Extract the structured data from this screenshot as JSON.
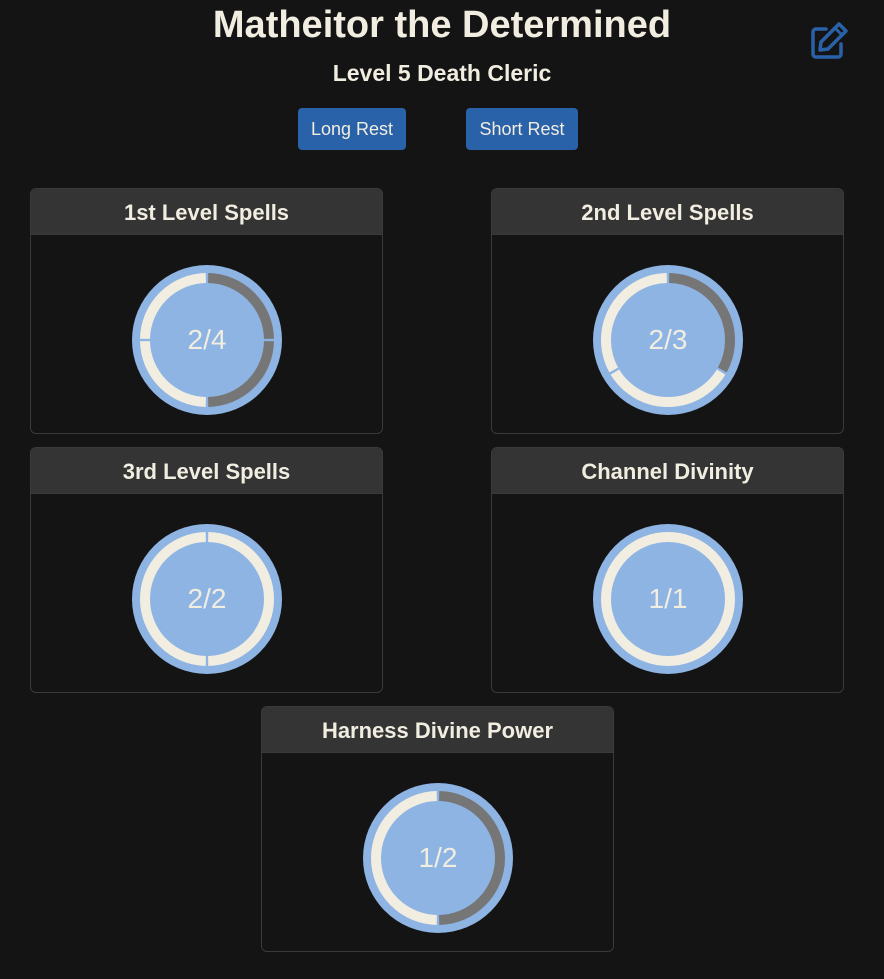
{
  "header": {
    "title": "Matheitor the Determined",
    "subtitle": "Level 5 Death Cleric"
  },
  "actions": {
    "long_rest_label": "Long Rest",
    "short_rest_label": "Short Rest",
    "edit_icon": "edit-icon"
  },
  "colors": {
    "background": "#141414",
    "card_header": "#343434",
    "button": "#2a62a9",
    "dial_fill": "#8eb4e3",
    "slot_available": "#f1ede0",
    "slot_used": "#767676",
    "text": "#f1ede0"
  },
  "resources": [
    {
      "name": "1st Level Spells",
      "current": 2,
      "max": 4,
      "label": "2/4"
    },
    {
      "name": "2nd Level Spells",
      "current": 2,
      "max": 3,
      "label": "2/3"
    },
    {
      "name": "3rd Level Spells",
      "current": 2,
      "max": 2,
      "label": "2/2"
    },
    {
      "name": "Channel Divinity",
      "current": 1,
      "max": 1,
      "label": "1/1"
    },
    {
      "name": "Harness Divine Power",
      "current": 1,
      "max": 2,
      "label": "1/2"
    }
  ]
}
